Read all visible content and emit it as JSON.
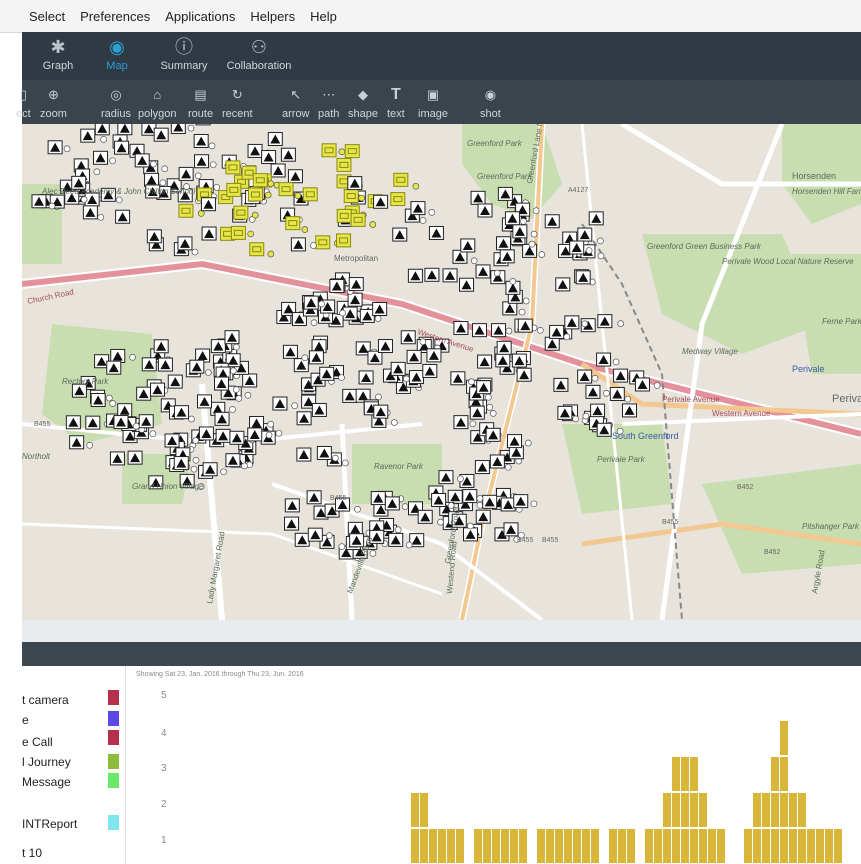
{
  "menubar": {
    "items": [
      "Select",
      "Preferences",
      "Applications",
      "Helpers",
      "Help"
    ]
  },
  "views": [
    {
      "label": "Graph",
      "icon": "graph-icon",
      "active": false
    },
    {
      "label": "Map",
      "icon": "globe-icon",
      "active": true
    },
    {
      "label": "Summary",
      "icon": "info-icon",
      "active": false
    },
    {
      "label": "Collaboration",
      "icon": "people-icon",
      "active": false
    }
  ],
  "tools": [
    {
      "label": "ect",
      "icon": "select-icon"
    },
    {
      "label": "zoom",
      "icon": "zoom-icon"
    },
    {
      "label": "radius",
      "icon": "radius-icon"
    },
    {
      "label": "polygon",
      "icon": "polygon-icon"
    },
    {
      "label": "route",
      "icon": "route-icon"
    },
    {
      "label": "recent",
      "icon": "recent-icon"
    },
    {
      "label": "arrow",
      "icon": "arrow-icon"
    },
    {
      "label": "path",
      "icon": "path-icon"
    },
    {
      "label": "shape",
      "icon": "shape-icon"
    },
    {
      "label": "text",
      "icon": "text-icon"
    },
    {
      "label": "image",
      "icon": "image-icon"
    },
    {
      "label": "shot",
      "icon": "camera-icon"
    }
  ],
  "map": {
    "places": [
      "Greenford Park",
      "Greenford Park",
      "Greenford Lane North",
      "A4127",
      "Horsenden Hill Farm",
      "Horsenden",
      "Greenford Green Business Park",
      "Perivale Wood Local Nature Reserve",
      "Medway Village",
      "Perivale",
      "Western Avenue",
      "Western Avenue",
      "Perivale",
      "South Greenford",
      "Perivale Park",
      "B452",
      "B455",
      "B455",
      "B455",
      "B452",
      "Ravenor Park",
      "Rectory Park",
      "B455",
      "Church Road",
      "Lady Margaret Road",
      "Westend Road",
      "Mandeville Road",
      "Alec Reed Academy & John Chilton School",
      "Northolt",
      "Metropolitan",
      "Grand Union Village",
      "Greenford Road",
      "Argyle Road",
      "Pitshanger Park",
      "Ferne Park",
      "Perivale Avenue",
      "B455"
    ]
  },
  "legend": {
    "items": [
      {
        "label": "t camera",
        "color": "#b5304a"
      },
      {
        "label": "e",
        "color": "#5b48e6"
      },
      {
        "label": "e Call",
        "color": "#b5304a"
      },
      {
        "label": "l Journey",
        "color": "#8dbb3b"
      },
      {
        "label": "Message",
        "color": "#6ae86a"
      },
      {
        "label": "INTReport",
        "color": "#7fe6ee"
      }
    ],
    "pager": "t 10"
  },
  "chart_data": {
    "type": "bar",
    "caption": "Showing Sat 23, Jan. 2016 through Thu 23, Jun. 2016",
    "yticks": [
      "5",
      "4",
      "3",
      "2",
      "1"
    ],
    "ylim": [
      0,
      5
    ],
    "bar_color": "#d9b63a",
    "x": [
      0,
      1,
      2,
      3,
      4,
      5,
      6,
      7,
      8,
      9,
      10,
      11,
      12,
      13,
      14,
      15,
      16,
      17,
      18,
      19,
      20,
      21,
      22,
      23,
      24,
      25,
      26,
      27,
      28,
      29,
      30,
      31,
      32,
      33,
      34,
      35,
      36,
      37,
      38,
      39,
      40,
      41,
      42,
      43,
      44,
      45,
      46,
      47,
      48,
      49,
      50,
      51
    ],
    "values": [
      2,
      2,
      1,
      1,
      1,
      1,
      0,
      1,
      1,
      1,
      1,
      1,
      1,
      0,
      1,
      1,
      1,
      1,
      1,
      1,
      1,
      0,
      1,
      1,
      1,
      0,
      1,
      1,
      2,
      3,
      3,
      3,
      2,
      1,
      1,
      0,
      0,
      1,
      2,
      2,
      3,
      4,
      2,
      2,
      1,
      1,
      1,
      1,
      0,
      0,
      0,
      0
    ]
  },
  "colors": {
    "menubar_bg": "#f4f4f4",
    "viewbar_bg": "#2f3a44",
    "toolbar_bg": "#3a444d",
    "active_accent": "#2a9fd6",
    "map_bg": "#e8e4dc",
    "map_green": "#c9deb0",
    "map_road": "#ffffff",
    "map_major_road": "#e3929c"
  }
}
